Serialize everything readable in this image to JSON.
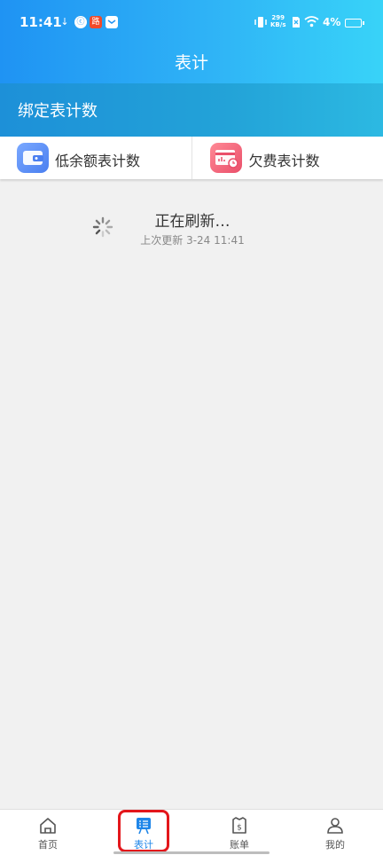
{
  "status_bar": {
    "time": "11:41",
    "net_speed_value": "299",
    "net_speed_unit": "KB/s",
    "battery": "4%",
    "app_badge_text": "路"
  },
  "header": {
    "title": "表计"
  },
  "bind_section": {
    "label": "绑定表计数"
  },
  "cards": [
    {
      "label": "低余额表计数",
      "icon": "wallet-icon",
      "color": "#5b8ff5"
    },
    {
      "label": "欠费表计数",
      "icon": "bill-clock-icon",
      "color": "#f0607a"
    }
  ],
  "refresh": {
    "title": "正在刷新…",
    "subtitle": "上次更新 3-24 11:41"
  },
  "tabbar": {
    "items": [
      {
        "label": "首页",
        "icon": "home-icon"
      },
      {
        "label": "表计",
        "icon": "meter-icon"
      },
      {
        "label": "账单",
        "icon": "bill-icon"
      },
      {
        "label": "我的",
        "icon": "profile-icon"
      }
    ],
    "active_index": 1
  },
  "colors": {
    "accent": "#1f86e8",
    "highlight": "#e3161b"
  }
}
